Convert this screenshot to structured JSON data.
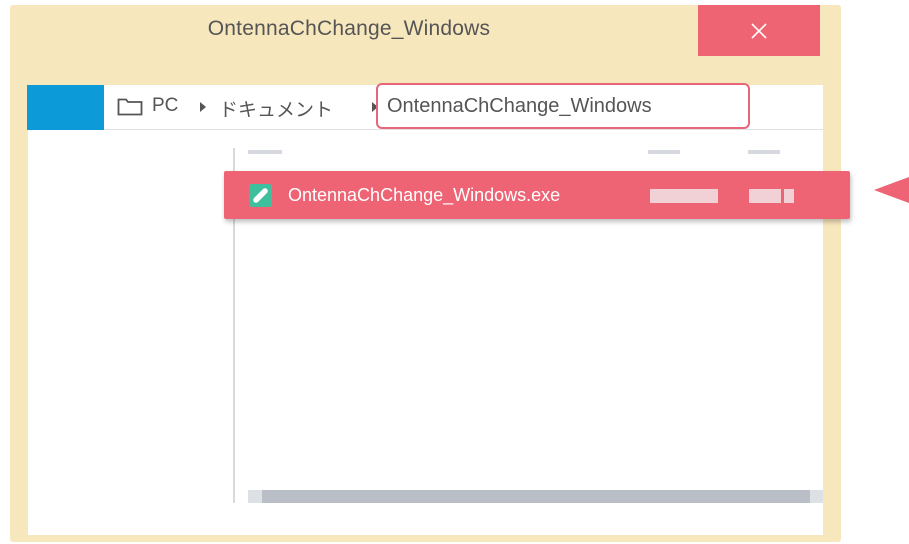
{
  "window": {
    "title": "OntennaChChange_Windows"
  },
  "breadcrumb": {
    "items": [
      "PC",
      "ドキュメント",
      "OntennaChChange_Windows"
    ]
  },
  "file_list": {
    "selected_file": {
      "name": "OntennaChChange_Windows.exe",
      "icon": "app-icon"
    }
  },
  "colors": {
    "window_bg": "#f7e7bd",
    "highlight": "#ee6475",
    "address_accent": "#0c9ad8",
    "file_icon": "#3ec09e"
  }
}
